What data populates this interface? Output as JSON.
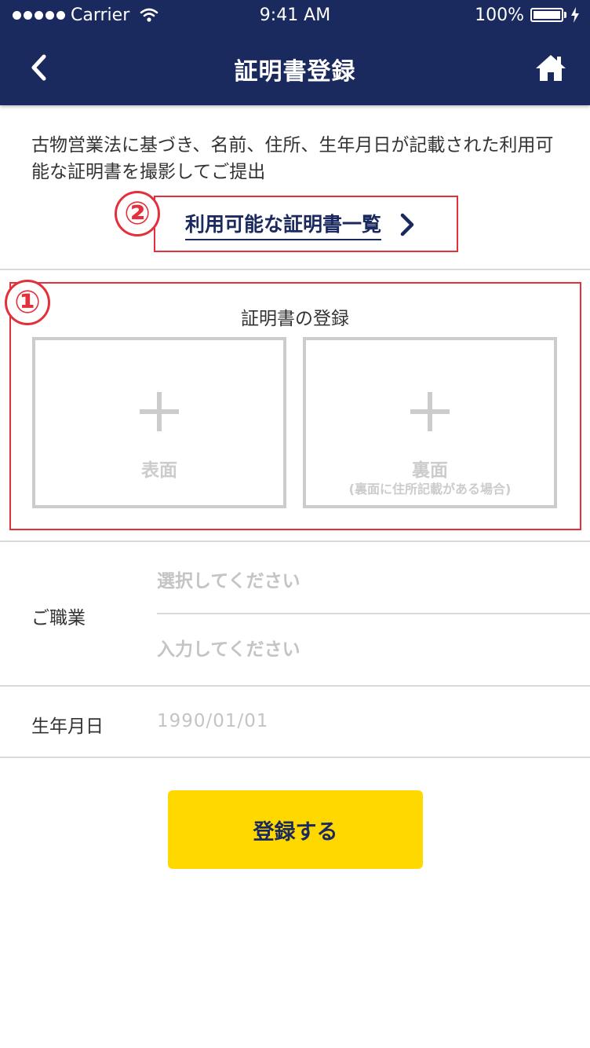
{
  "status_bar": {
    "carrier": "Carrier",
    "time": "9:41 AM",
    "battery": "100%"
  },
  "nav": {
    "title": "証明書登録",
    "back_icon": "chevron-left-icon",
    "home_icon": "home-icon"
  },
  "intro": {
    "text": "古物営業法に基づき、名前、住所、生年月日が記載された利用可能な証明書を撮影してご提出",
    "link_label": "利用可能な証明書一覧",
    "link_icon": "chevron-right-icon"
  },
  "annotations": {
    "badge_1": "①",
    "badge_2": "②",
    "color": "#e3303a"
  },
  "upload": {
    "title": "証明書の登録",
    "front": {
      "label": "表面",
      "icon": "plus-icon"
    },
    "back": {
      "label": "裏面",
      "note": "(裏面に住所記載がある場合)",
      "icon": "plus-icon"
    }
  },
  "occupation": {
    "label": "ご職業",
    "select_placeholder": "選択してください",
    "input_placeholder": "入力してください"
  },
  "birthday": {
    "label": "生年月日",
    "placeholder": "1990/01/01"
  },
  "submit": {
    "label": "登録する"
  },
  "colors": {
    "nav_background": "#1b2a5e",
    "submit_background": "#ffd800",
    "tile_border": "#cccccc"
  }
}
